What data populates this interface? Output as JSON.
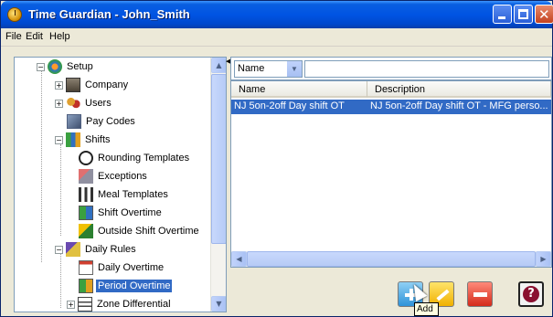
{
  "window": {
    "title": "Time Guardian - John_Smith",
    "controls": [
      "minimize",
      "maximize",
      "close"
    ]
  },
  "menu": [
    "File",
    "Edit",
    "Help"
  ],
  "tree": [
    {
      "label": "Setup",
      "icon": "setup-icon",
      "expanded": true
    },
    {
      "label": "Company",
      "icon": "company-icon"
    },
    {
      "label": "Users",
      "icon": "users-icon"
    },
    {
      "label": "Pay Codes",
      "icon": "pay-codes-icon"
    },
    {
      "label": "Shifts",
      "icon": "shifts-icon",
      "expanded": true
    },
    {
      "label": "Rounding Templates",
      "icon": "clock-icon"
    },
    {
      "label": "Exceptions",
      "icon": "exceptions-icon"
    },
    {
      "label": "Meal Templates",
      "icon": "meal-icon"
    },
    {
      "label": "Shift Overtime",
      "icon": "shift-overtime-icon"
    },
    {
      "label": "Outside Shift Overtime",
      "icon": "outside-overtime-icon"
    },
    {
      "label": "Daily Rules",
      "icon": "daily-rules-icon",
      "expanded": true
    },
    {
      "label": "Daily Overtime",
      "icon": "daily-overtime-icon"
    },
    {
      "label": "Period Overtime",
      "icon": "period-overtime-icon",
      "selected": true
    },
    {
      "label": "Zone Differential",
      "icon": "zone-differential-icon"
    }
  ],
  "filter": {
    "field_selected": "Name",
    "search_value": ""
  },
  "grid": {
    "columns": [
      "Name",
      "Description"
    ],
    "rows": [
      {
        "name": "NJ 5on-2off Day shift OT",
        "description": "NJ 5on-2off Day shift OT - MFG perso..."
      }
    ]
  },
  "actions": {
    "add": "add-icon",
    "edit": "edit-icon",
    "delete": "delete-icon",
    "help": "help-icon"
  },
  "tooltip": "Add",
  "colors": {
    "titlebar": "#0054e3",
    "selection": "#316ac5",
    "face": "#ece9d8"
  }
}
